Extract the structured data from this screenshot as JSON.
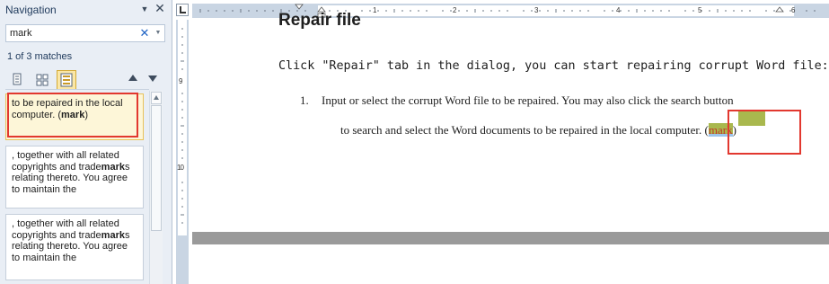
{
  "navigation": {
    "title": "Navigation",
    "search": {
      "value": "mark",
      "clear_icon": "close-icon",
      "dropdown_icon": "chevron-down-icon"
    },
    "match_count": "1 of 3 matches",
    "view_tabs": [
      {
        "name": "headings-view",
        "icon": "document-icon",
        "selected": false
      },
      {
        "name": "pages-view",
        "icon": "grid-icon",
        "selected": false
      },
      {
        "name": "results-view",
        "icon": "list-icon",
        "selected": true
      }
    ],
    "results": [
      {
        "before": "to be repaired in the local computer. (",
        "match": "mark",
        "after": ")",
        "current": true
      },
      {
        "before": ", together with all related copyrights and trade",
        "match": "mark",
        "after": "s relating thereto. You agree to maintain the",
        "current": false
      },
      {
        "before": ", together with all related copyrights and trade",
        "match": "mark",
        "after": "s relating thereto. You agree to maintain the",
        "current": false
      }
    ]
  },
  "ruler": {
    "h_numbers": [
      "1",
      "2",
      "3",
      "4",
      "5",
      "6"
    ],
    "v_numbers": [
      "9",
      "10"
    ]
  },
  "document": {
    "heading": "Repair file",
    "instruction": "Click \"Repair\" tab in the dialog, you can start repairing corrupt Word file:",
    "list_number": "1.",
    "line1": "Input or select the corrupt Word file to be repaired. You may also click the search button",
    "line2_before": "to search and select the Word documents to be repaired in the local computer. (",
    "line2_match": "mark",
    "line2_after": ")"
  },
  "colors": {
    "highlight_border": "#e2382f",
    "match_highlight": "#a9b84e",
    "selection": "#9cc4eb",
    "current_result": "#fdf6d8"
  }
}
